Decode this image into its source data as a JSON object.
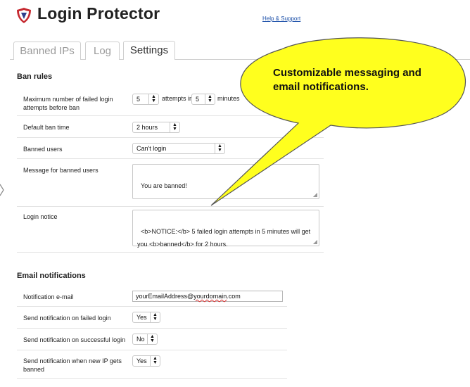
{
  "app": {
    "title": "Login Protector",
    "help_link": "Help & Support"
  },
  "tabs": [
    {
      "label": "Banned IPs",
      "active": false
    },
    {
      "label": "Log",
      "active": false
    },
    {
      "label": "Settings",
      "active": true
    }
  ],
  "callout": {
    "text": "Customizable messaging and email notifications."
  },
  "ban_rules": {
    "title": "Ban rules",
    "max_failed": {
      "label": "Maximum number of failed login attempts before ban",
      "attempts": "5",
      "attempts_in_text": "attempts in",
      "minutes": "5",
      "minutes_text": "minutes"
    },
    "default_ban_time": {
      "label": "Default ban time",
      "value": "2 hours"
    },
    "banned_users": {
      "label": "Banned users",
      "value": "Can't login"
    },
    "message": {
      "label": "Message for banned users",
      "value": "You are banned!"
    },
    "login_notice": {
      "label": "Login notice",
      "value": "<b>NOTICE:</b> 5 failed login attempts in 5 minutes will get you <b>banned</b> for 2 hours."
    }
  },
  "email": {
    "title": "Email notifications",
    "notification_email": {
      "label": "Notification e-mail",
      "value_prefix": "yourEmailAddress@",
      "value_domain": "yourdomain",
      "value_suffix": ".com"
    },
    "on_failed": {
      "label": "Send notification on failed login",
      "value": "Yes"
    },
    "on_success": {
      "label": "Send notification on successful login",
      "value": "No"
    },
    "on_new_ip": {
      "label": "Send notification when new IP gets banned",
      "value": "Yes"
    }
  },
  "colors": {
    "logo_red": "#c62a31",
    "logo_blue": "#2d3e8c",
    "callout_fill": "#ffff1e",
    "link": "#1a4ea8"
  }
}
